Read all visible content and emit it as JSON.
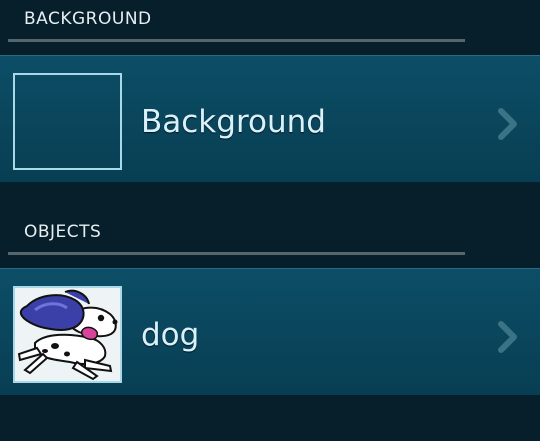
{
  "sections": [
    {
      "header": "BACKGROUND",
      "items": [
        {
          "label": "Background",
          "thumbnail": "empty-background"
        }
      ]
    },
    {
      "header": "OBJECTS",
      "items": [
        {
          "label": "dog",
          "thumbnail": "dog-sprite"
        }
      ]
    }
  ],
  "colors": {
    "app_background": "#071f2a",
    "row_background": "#0b4a61",
    "thumbnail_border": "#a9d9e8",
    "label_text": "#d8f1fa",
    "header_text": "#e7eef1",
    "divider": "#55666d",
    "chevron": "#3a7386"
  },
  "icons": {
    "chevron": "chevron-right-icon"
  }
}
